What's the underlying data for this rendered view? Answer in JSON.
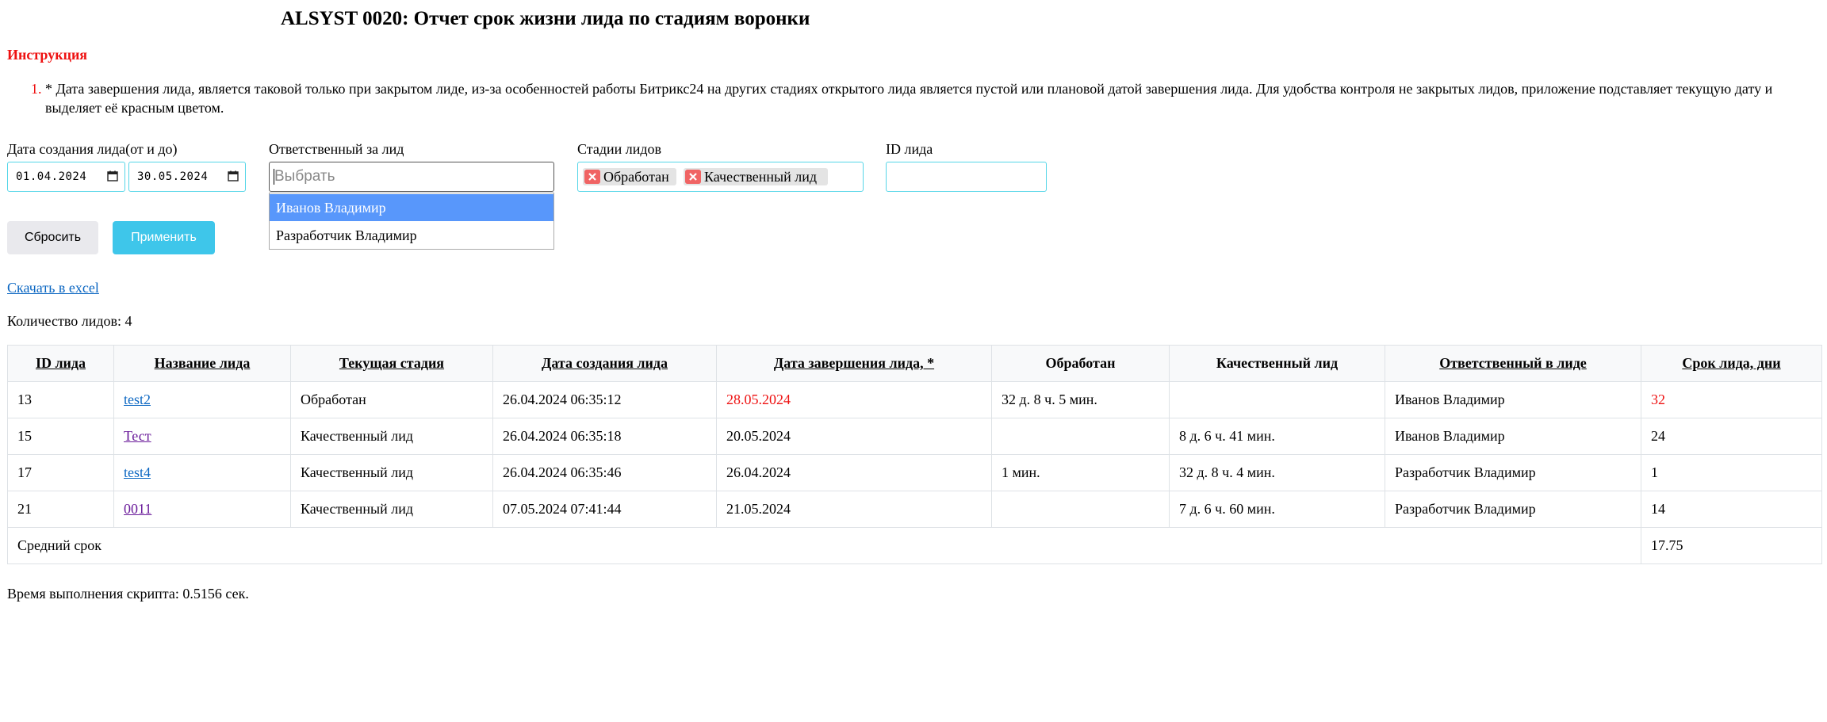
{
  "title": "ALSYST 0020: Отчет срок жизни лида по стадиям воронки",
  "instruction": {
    "heading": "Инструкция",
    "items": [
      {
        "number": "1.",
        "text": "* Дата завершения лида, является таковой только при закрытом лиде, из-за особенностей работы Битрикс24 на других стадиях открытого лида является пустой или плановой датой завершения лида. Для удобства контроля не закрытых лидов, приложение подставляет текущую дату и выделяет её красным цветом."
      }
    ]
  },
  "filters": {
    "date": {
      "label": "Дата создания лида(от и до)",
      "from": "01.04.2024",
      "to": "30.05.2024"
    },
    "responsible": {
      "label": "Ответственный за лид",
      "placeholder": "Выбрать",
      "options": [
        "Иванов Владимир",
        "Разработчик Владимир"
      ]
    },
    "stages": {
      "label": "Стадии лидов",
      "selected": [
        "Обработан",
        "Качественный лид"
      ]
    },
    "lead_id": {
      "label": "ID лида",
      "value": ""
    }
  },
  "buttons": {
    "reset": "Сбросить",
    "apply": "Применить"
  },
  "download_link": "Скачать в excel",
  "lead_count": "Количество лидов: 4",
  "table": {
    "headers": [
      "ID лида",
      "Название лида",
      "Текущая стадия",
      "Дата создания лида",
      "Дата завершения лида, *",
      "Обработан",
      "Качественный лид",
      "Ответственный в лиде",
      "Срок лида, дни"
    ],
    "rows": [
      [
        "13",
        "test2",
        "Обработан",
        "26.04.2024 06:35:12",
        "28.05.2024",
        "32 д. 8 ч. 5 мин.",
        "",
        "Иванов Владимир",
        "32"
      ],
      [
        "15",
        "Тест",
        "Качественный лид",
        "26.04.2024 06:35:18",
        "20.05.2024",
        "",
        "8 д. 6 ч. 41 мин.",
        "Иванов Владимир",
        "24"
      ],
      [
        "17",
        "test4",
        "Качественный лид",
        "26.04.2024 06:35:46",
        "26.04.2024",
        "1 мин.",
        "32 д. 8 ч. 4 мин.",
        "Разработчик Владимир",
        "1"
      ],
      [
        "21",
        "0011",
        "Качественный лид",
        "07.05.2024 07:41:44",
        "21.05.2024",
        "",
        "7 д. 6 ч. 60 мин.",
        "Разработчик Владимир",
        "14"
      ]
    ],
    "footer": {
      "label": "Средний срок",
      "value": "17.75"
    }
  },
  "exec_time": "Время выполнения скрипта: 0.5156 сек.",
  "colors": {
    "accent": "#3ec6ea",
    "warning": "#ee1111",
    "link": "#0a66c2",
    "link_visited": "#6a1b9a",
    "dropdown_active": "#5897fb"
  }
}
